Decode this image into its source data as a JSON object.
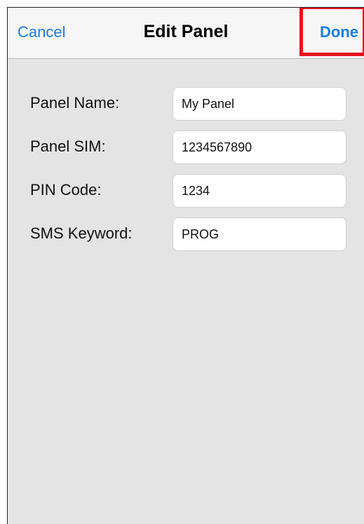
{
  "nav": {
    "cancel_label": "Cancel",
    "title": "Edit Panel",
    "done_label": "Done"
  },
  "form": {
    "fields": [
      {
        "label": "Panel Name:",
        "value": "My Panel"
      },
      {
        "label": "Panel SIM:",
        "value": "1234567890"
      },
      {
        "label": "PIN Code:",
        "value": "1234"
      },
      {
        "label": "SMS Keyword:",
        "value": "PROG"
      }
    ]
  },
  "colors": {
    "accent": "#1a7ee0",
    "highlight": "#e8141c",
    "background": "#e4e4e4",
    "nav_background": "#f6f6f6"
  }
}
